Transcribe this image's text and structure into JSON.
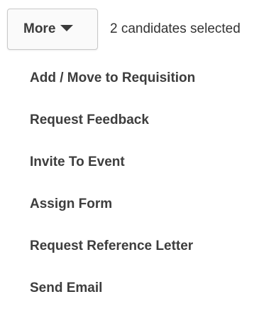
{
  "toolbar": {
    "more_label": "More",
    "more_icon": "caret-down-icon",
    "selection_status": "2 candidates selected"
  },
  "menu": {
    "items": [
      {
        "label": "Add / Move to Requisition"
      },
      {
        "label": "Request Feedback"
      },
      {
        "label": "Invite To Event"
      },
      {
        "label": "Assign Form"
      },
      {
        "label": "Request Reference Letter"
      },
      {
        "label": "Send Email"
      }
    ]
  }
}
